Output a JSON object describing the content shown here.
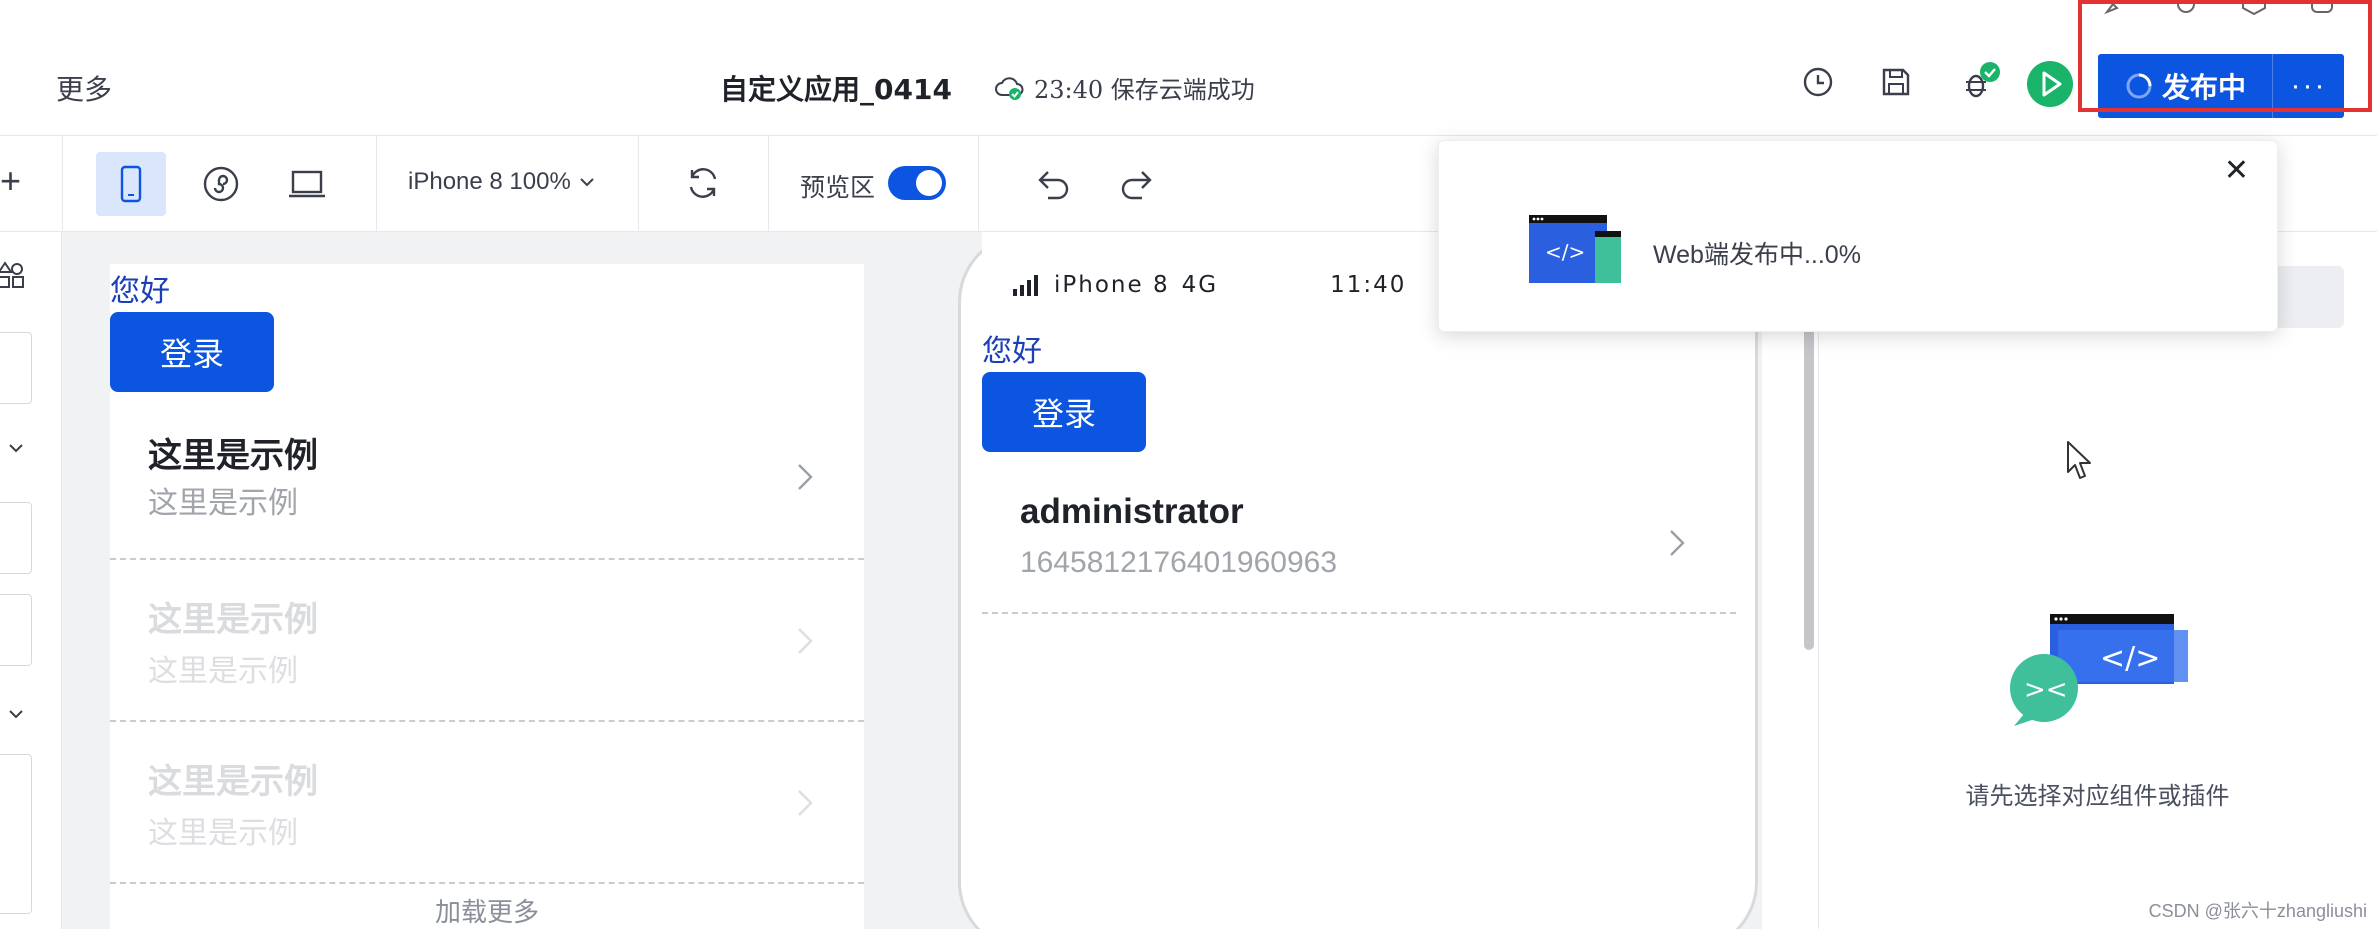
{
  "header": {
    "more_label": "更多",
    "app_title": "自定义应用_0414",
    "save_status": "23:40 保存云端成功",
    "publish_label": "发布中",
    "publish_more_label": "···"
  },
  "toolbar": {
    "add_label": "+",
    "device_select": "iPhone 8 100%",
    "preview_label": "预览区",
    "preview_on": true
  },
  "editor": {
    "hello": "您好",
    "login": "登录",
    "items": [
      {
        "title": "这里是示例",
        "subtitle": "这里是示例"
      },
      {
        "title": "这里是示例",
        "subtitle": "这里是示例"
      },
      {
        "title": "这里是示例",
        "subtitle": "这里是示例"
      }
    ],
    "load_more": "加载更多"
  },
  "phone": {
    "device": "iPhone 8",
    "network": "4G",
    "time": "11:40",
    "hello": "您好",
    "login": "登录",
    "user_name": "administrator",
    "user_id": "1645812176401960963"
  },
  "popup": {
    "message": "Web端发布中...0%",
    "close": "✕"
  },
  "right_panel": {
    "empty_text": "请先选择对应组件或插件"
  },
  "watermark": "CSDN @张六十zhangliushi",
  "colors": {
    "accent": "#0b55e0",
    "highlight": "#e23232",
    "success": "#19b46a"
  }
}
